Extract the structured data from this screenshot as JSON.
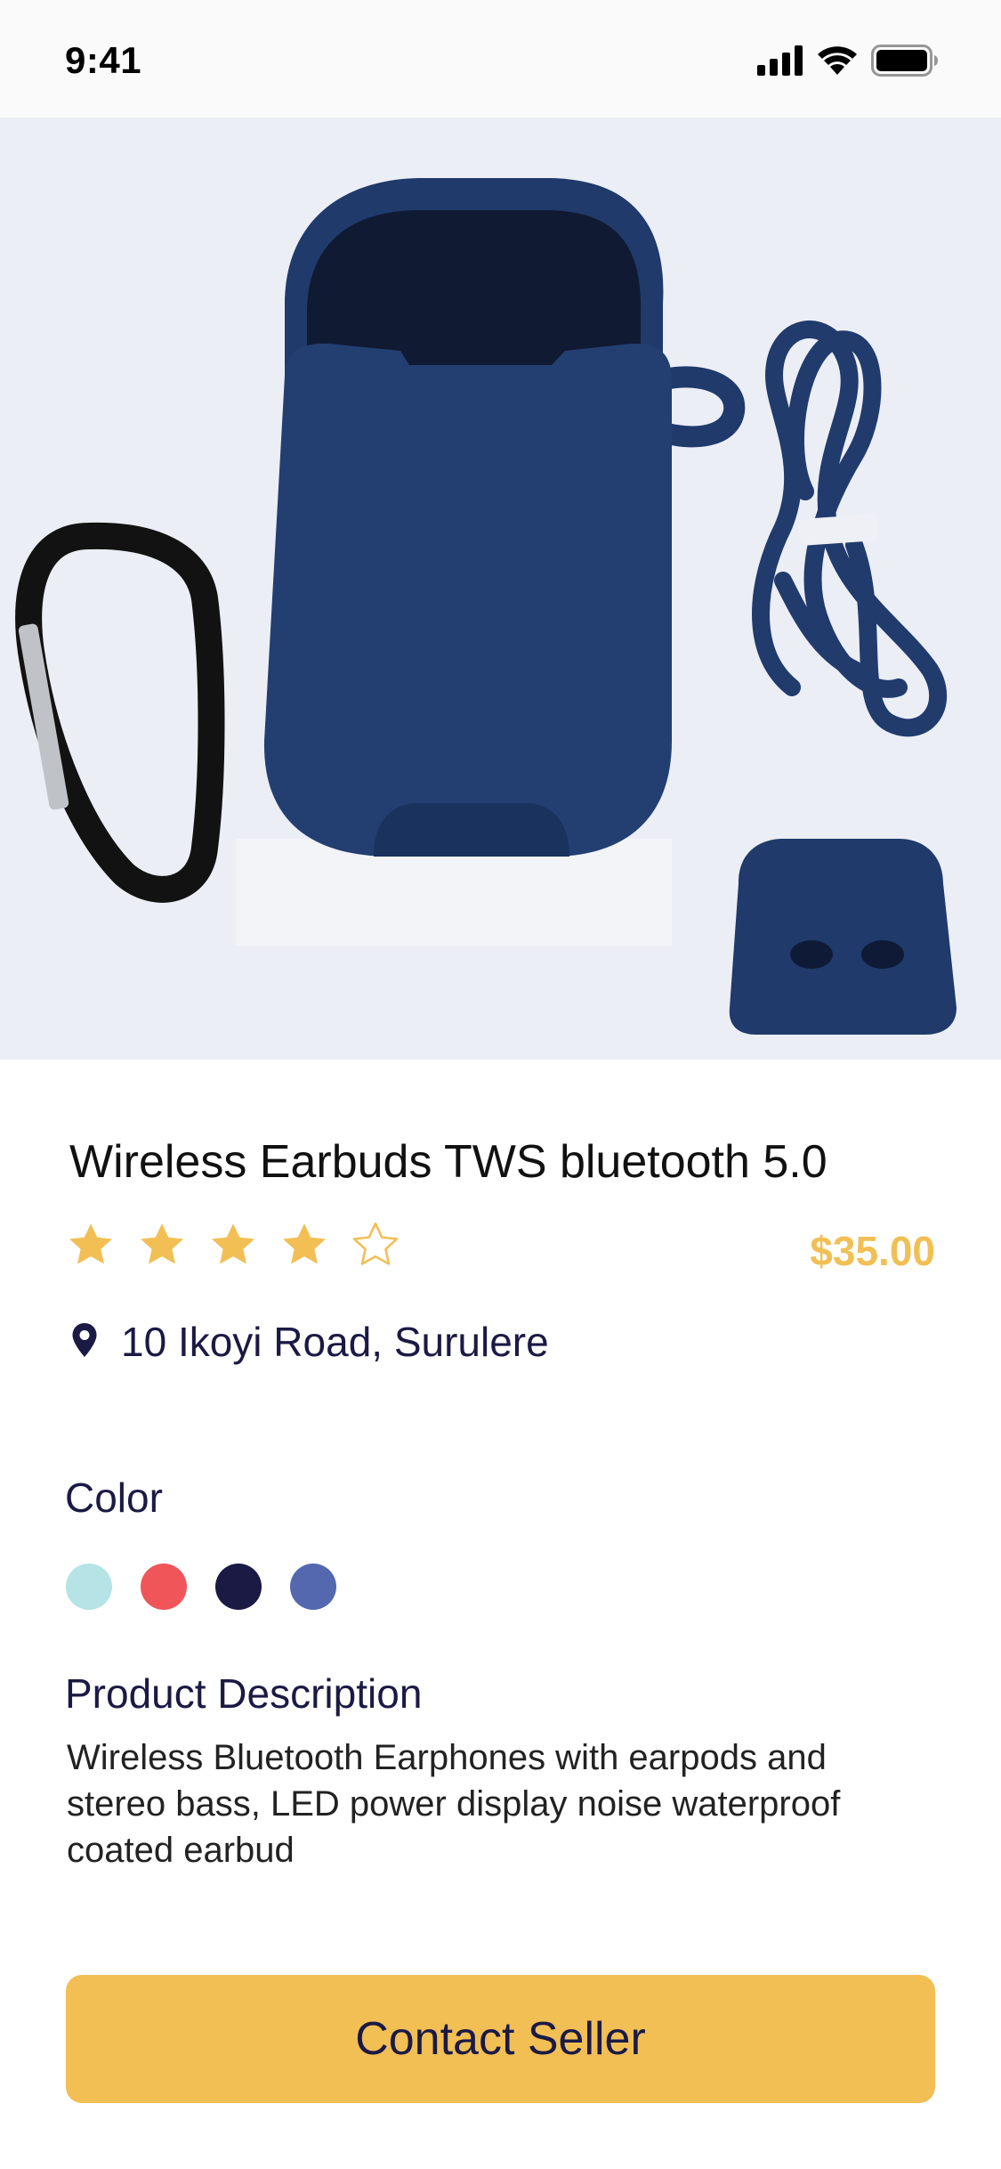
{
  "status_bar": {
    "time": "9:41"
  },
  "product": {
    "title": "Wireless Earbuds TWS bluetooth 5.0",
    "rating": 4,
    "rating_max": 5,
    "price": "$35.00",
    "location": "10 Ikoyi Road, Surulere"
  },
  "colors": {
    "label": "Color",
    "options": [
      "#b5e3e6",
      "#f0555a",
      "#1b1a45",
      "#5468b0"
    ]
  },
  "description": {
    "label": "Product Description",
    "text": "Wireless Bluetooth Earphones  with earpods and stereo bass, LED power display noise waterproof coated earbud"
  },
  "actions": {
    "contact_label": "Contact Seller"
  },
  "theme": {
    "accent": "#f2bf55",
    "text_dark": "#1b1a45"
  },
  "icons": {
    "signal": "signal-icon",
    "wifi": "wifi-icon",
    "battery": "battery-icon",
    "location": "location-pin-icon",
    "star_filled": "star-filled-icon",
    "star_empty": "star-outline-icon"
  }
}
